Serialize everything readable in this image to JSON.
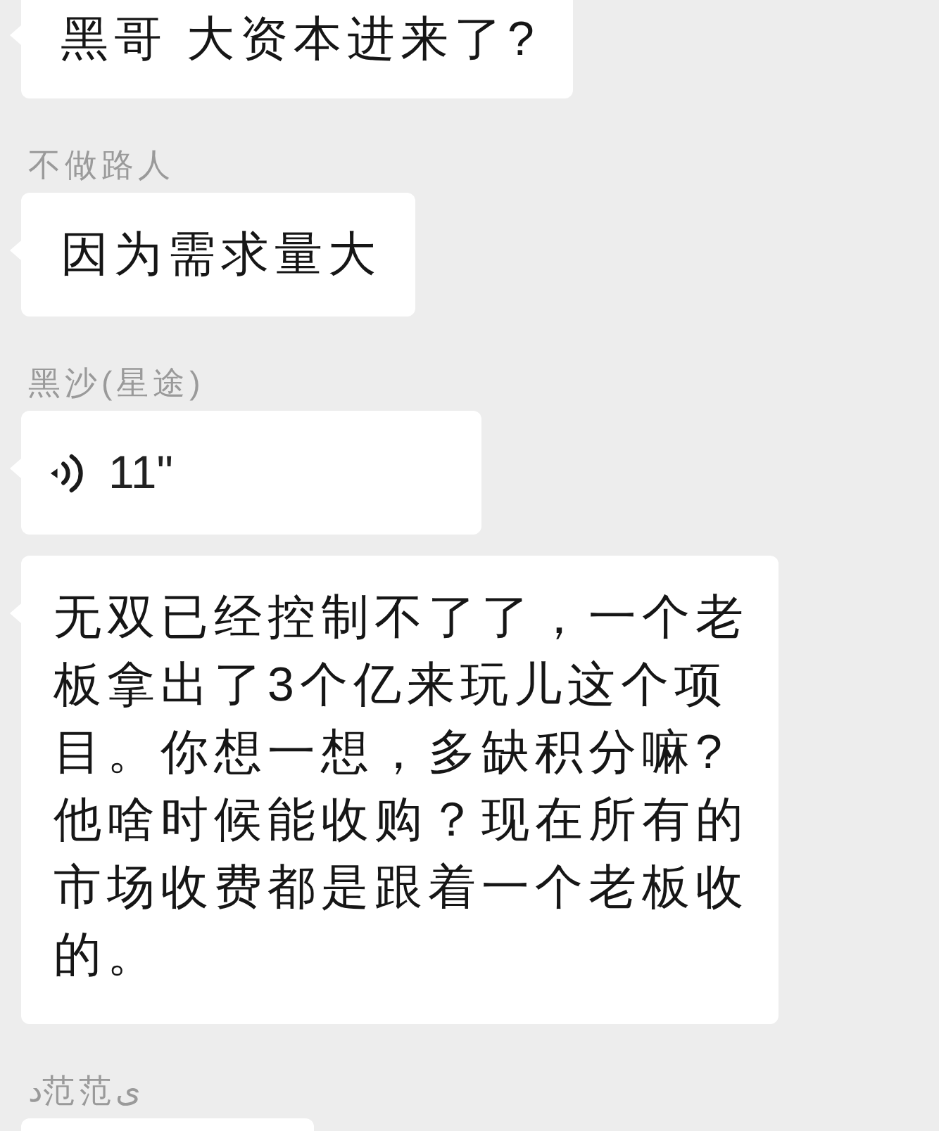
{
  "messages": [
    {
      "kind": "text",
      "text": "黑哥 大资本进来了?"
    },
    {
      "kind": "text",
      "sender": "不做路人",
      "text": "因为需求量大"
    },
    {
      "kind": "voice",
      "sender": "黑沙(星途)",
      "duration": "11\""
    },
    {
      "kind": "text",
      "text": "无双已经控制不了了，一个老板拿出了3个亿来玩儿这个项目。你想一想，多缺积分嘛?他啥时候能收购？现在所有的市场收费都是跟着一个老板收的。"
    },
    {
      "kind": "partial",
      "sender": "د范范ى"
    }
  ]
}
